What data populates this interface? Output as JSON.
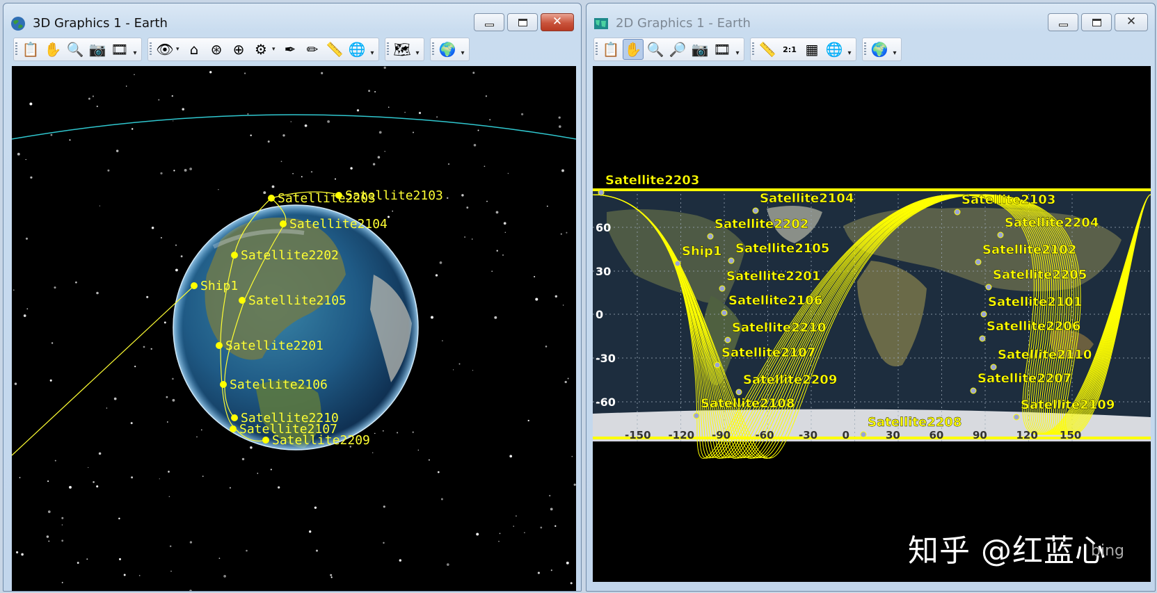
{
  "window_3d": {
    "title": "3D Graphics 1 - Earth",
    "close_symbol": "✕",
    "labels": [
      {
        "text": "Satellite2203"
      },
      {
        "text": "Satellite2103"
      },
      {
        "text": "Satellite2104"
      },
      {
        "text": "Satellite2202"
      },
      {
        "text": "Ship1"
      },
      {
        "text": "Satellite2105"
      },
      {
        "text": "Satellite2201"
      },
      {
        "text": "Satellite2106"
      },
      {
        "text": "Satellite2210"
      },
      {
        "text": "Satellite2107"
      },
      {
        "text": "Satellite2209"
      }
    ],
    "toolbar_icons": [
      "properties-icon",
      "pan-hand-icon",
      "zoom-in-icon",
      "snapshot-icon",
      "record-icon",
      "view-from-icon",
      "home-view-icon",
      "orbit-view-icon",
      "target-view-icon",
      "object-view-icon",
      "pick-icon",
      "draw-icon",
      "measure-icon",
      "globe-manager-icon",
      "terrain-icon",
      "earth-icon"
    ]
  },
  "window_2d": {
    "title": "2D Graphics 1 - Earth",
    "close_symbol": "✕",
    "labels": [
      {
        "text": "Satellite2203"
      },
      {
        "text": "Satellite2104"
      },
      {
        "text": "Satellite2103"
      },
      {
        "text": "Satellite2202"
      },
      {
        "text": "Satellite2204"
      },
      {
        "text": "Ship1"
      },
      {
        "text": "Satellite2105"
      },
      {
        "text": "Satellite2102"
      },
      {
        "text": "Satellite2201"
      },
      {
        "text": "Satellite2205"
      },
      {
        "text": "Satellite2106"
      },
      {
        "text": "Satellite2101"
      },
      {
        "text": "Satellite2210"
      },
      {
        "text": "Satellite2206"
      },
      {
        "text": "Satellite2107"
      },
      {
        "text": "Satellite2110"
      },
      {
        "text": "Satellite2209"
      },
      {
        "text": "Satellite2207"
      },
      {
        "text": "Satellite2108"
      },
      {
        "text": "Satellite2109"
      },
      {
        "text": "Satellite2208"
      }
    ],
    "lat_ticks": [
      "60",
      "30",
      "0",
      "-30",
      "-60"
    ],
    "lon_ticks": [
      "-150",
      "-120",
      "-90",
      "-60",
      "-30",
      "0",
      "30",
      "60",
      "90",
      "120",
      "150"
    ],
    "toolbar_icons": [
      "properties-icon",
      "pan-hand-icon",
      "zoom-in-icon",
      "zoom-out-icon",
      "snapshot-icon",
      "record-icon",
      "measure-icon",
      "scale-ratio-icon",
      "map-grid-icon",
      "globe-manager-icon",
      "earth-icon"
    ],
    "scale_ratio_label": "2:1"
  },
  "watermark": "知乎 @红蓝心",
  "watermark_small": "bing",
  "colors": {
    "satellite_yellow": "#ffff00",
    "orbit_cyan": "#30c8d0",
    "space_black": "#000000"
  }
}
